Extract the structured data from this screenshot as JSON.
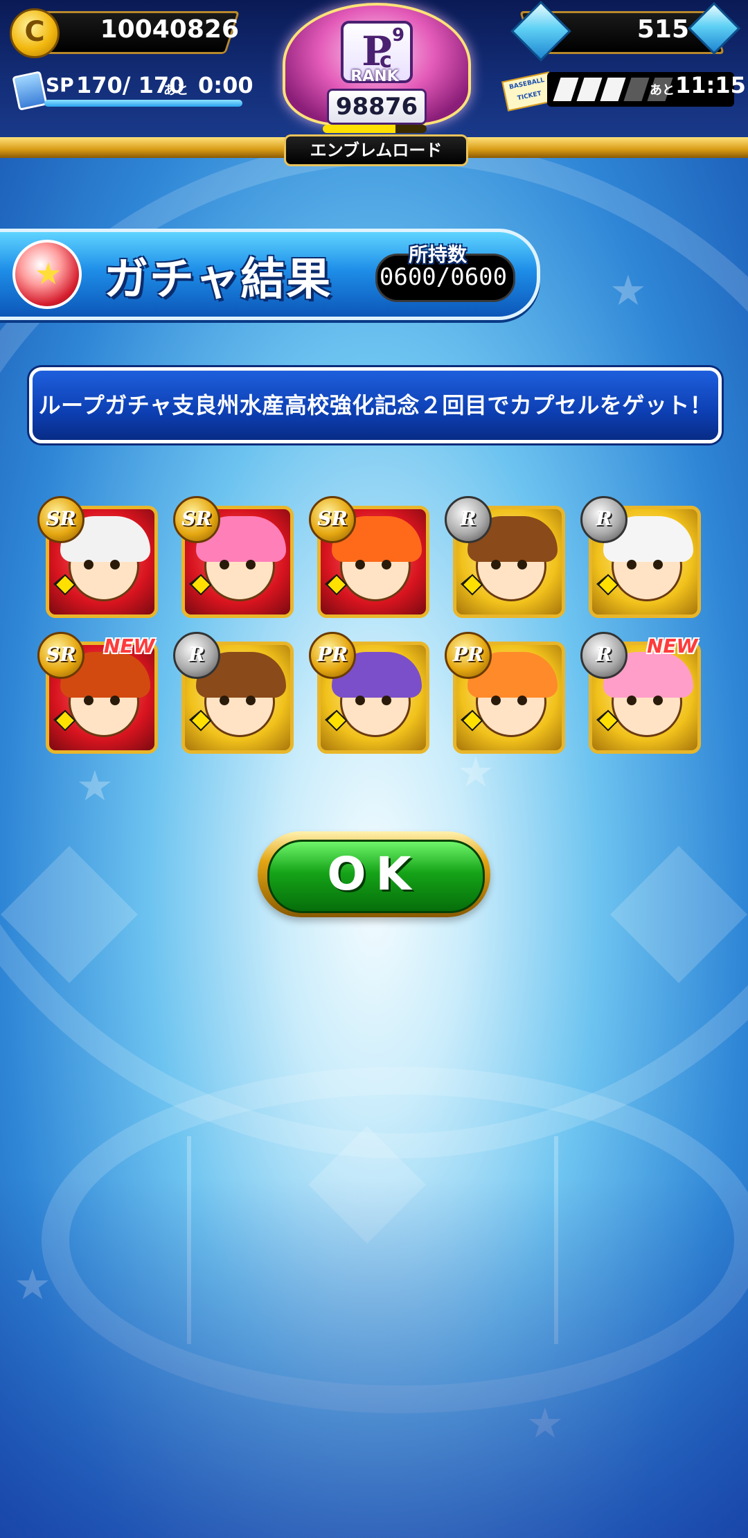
{
  "header": {
    "coins": "10040826",
    "coin_icon_glyph": "C",
    "gems": "515",
    "sp_label": "SP",
    "sp_value": "170/ 170",
    "sp_ato": "あと",
    "sp_time": "0:00",
    "sp_fill_fraction": 1.0,
    "ticket_label": "BASEBALL TICKET",
    "ticket_gauge_filled": 3,
    "ticket_gauge_total": 5,
    "ticket_ato": "あと",
    "ticket_time": "11:15"
  },
  "rank": {
    "letter": "P",
    "superscript": "9",
    "subscript": "c",
    "label": "RANK",
    "points": "98876",
    "progress_fraction": 0.7,
    "emblem_road_label": "エンブレムロード"
  },
  "title": {
    "text": "ガチャ結果",
    "owned_label": "所持数",
    "owned_value": "0600/0600"
  },
  "message": "ループガチャ支良州水産高校強化記念２回目でカプセルをゲット！",
  "results": [
    {
      "rarity": "SR",
      "is_new": false,
      "theme": "red",
      "hair": "#f2f2f2"
    },
    {
      "rarity": "SR",
      "is_new": false,
      "theme": "red",
      "hair": "#ff7fb8"
    },
    {
      "rarity": "SR",
      "is_new": false,
      "theme": "red",
      "hair": "#ff6a1a"
    },
    {
      "rarity": "R",
      "is_new": false,
      "theme": "gold",
      "hair": "#8a4a1a"
    },
    {
      "rarity": "R",
      "is_new": false,
      "theme": "gold",
      "hair": "#f5f5f5"
    },
    {
      "rarity": "SR",
      "is_new": true,
      "theme": "red",
      "hair": "#d24a10"
    },
    {
      "rarity": "R",
      "is_new": false,
      "theme": "gold",
      "hair": "#8a4a1a"
    },
    {
      "rarity": "PR",
      "is_new": false,
      "theme": "gold",
      "hair": "#7b4fc9"
    },
    {
      "rarity": "PR",
      "is_new": false,
      "theme": "gold",
      "hair": "#ff8a2a"
    },
    {
      "rarity": "R",
      "is_new": true,
      "theme": "gold",
      "hair": "#ff9ec8"
    }
  ],
  "new_label": "NEW",
  "ok_button": "OK",
  "colors": {
    "sr_border": "#e9b62a",
    "red_card_bg": "#d8141f",
    "gold_card_bg": "#f2c21c"
  }
}
